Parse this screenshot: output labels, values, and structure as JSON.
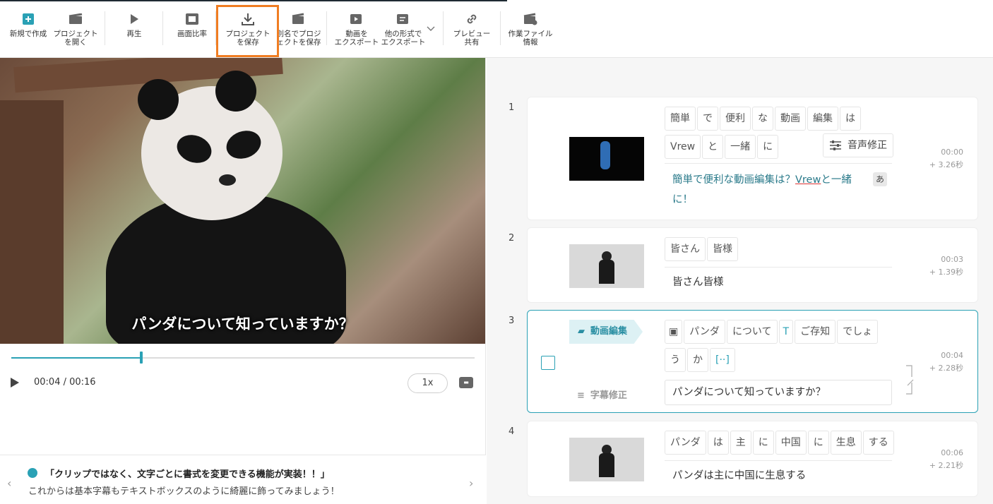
{
  "toolbar": {
    "new": "新規で作成",
    "open": "プロジェクト\nを開く",
    "play": "再生",
    "ratio": "画面比率",
    "save": "プロジェクト\nを保存",
    "save_as": "別名でプロジ\nェクトを保存",
    "export_video": "動画を\nエクスポート",
    "export_other": "他の形式で\nエクスポート",
    "preview_share": "プレビュー\n共有",
    "file_info": "作業ファイル\n情報"
  },
  "player": {
    "subtitle": "パンダについて知っていますか？",
    "time": "00:04 / 00:16",
    "speed": "1x",
    "progress": 0.28
  },
  "news": {
    "title": "「クリップではなく、文字ごとに書式を変更できる機能が実装！！」",
    "body": "これからは基本字幕もテキストボックスのように綺麗に飾ってみましょう！"
  },
  "clips": [
    {
      "num": "1",
      "words": [
        "簡単",
        "で",
        "便利",
        "な",
        "動画",
        "編集",
        "は",
        "Vrew",
        "と",
        "一緒",
        "に"
      ],
      "voice_fix": "音声修正",
      "kana": "あ",
      "subtitle_a": "簡単で便利な動画編集は？",
      "subtitle_b": "Vrew",
      "subtitle_c": "と一緒",
      "subtitle_d": "に！",
      "start": "00:00",
      "duration": "+  3.26秒"
    },
    {
      "num": "2",
      "words": [
        "皆さん",
        "皆様"
      ],
      "subtitle": "皆さん皆様",
      "start": "00:03",
      "duration": "+  1.39秒"
    },
    {
      "num": "3",
      "tag": "動画編集",
      "words": [
        "パンダ",
        "について",
        "ご存知",
        "でしょ",
        "う",
        "か",
        "[··]"
      ],
      "edit_label": "字幕修正",
      "subtitle": "パンダについて知っていますか？",
      "start": "00:04",
      "duration": "+  2.28秒"
    },
    {
      "num": "4",
      "words": [
        "パンダ",
        "は",
        "主",
        "に",
        "中国",
        "に",
        "生息",
        "する"
      ],
      "subtitle": "パンダは主に中国に生息する",
      "start": "00:06",
      "duration": "+  2.21秒"
    }
  ],
  "colors": {
    "accent": "#2aa1b5",
    "highlight": "#f07d22"
  }
}
